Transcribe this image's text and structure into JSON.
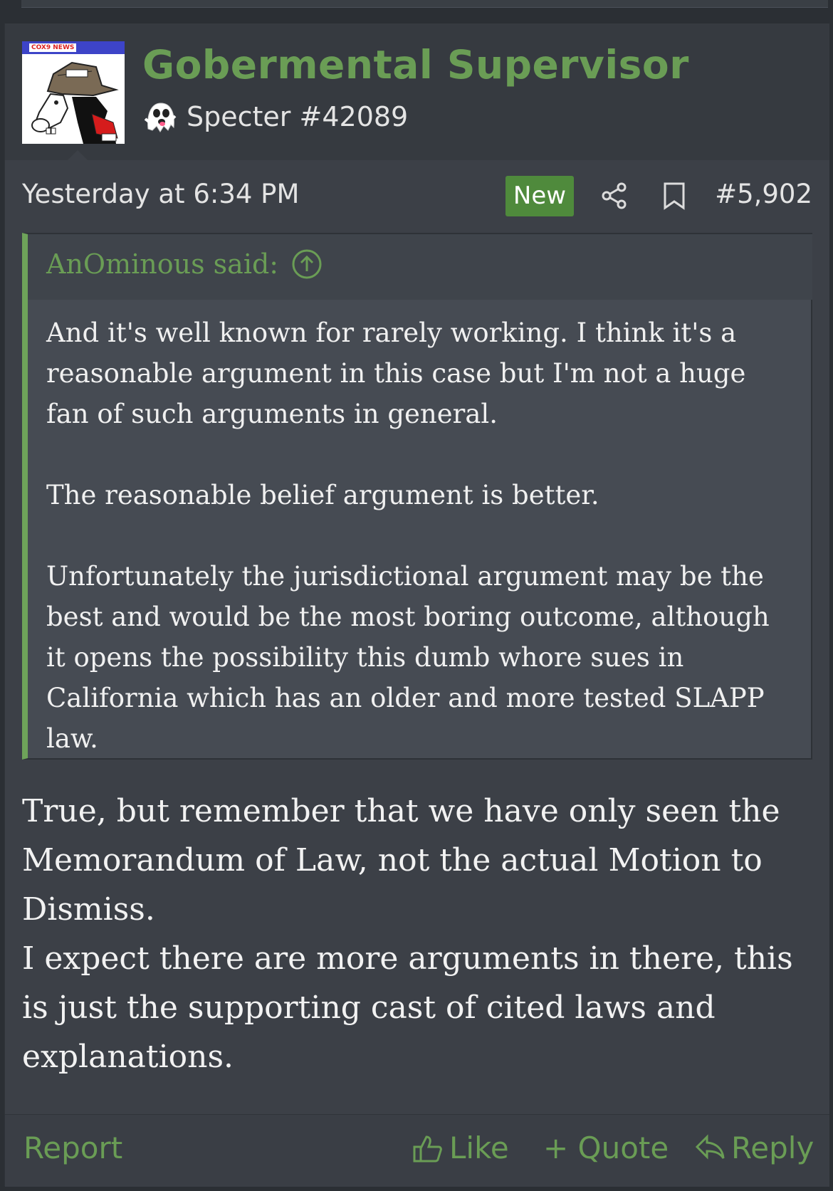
{
  "post": {
    "username": "Gobermental Supervisor",
    "user_title": "Specter #42089",
    "user_title_icon": "ghost-icon",
    "avatar_tag": "COX9 NEWS",
    "date": "Yesterday at 6:34 PM",
    "new_badge": "New",
    "post_number": "#5,902"
  },
  "quote": {
    "author": "AnOminous said:",
    "paragraphs": [
      "And it's well known for rarely working. I think it's a reasonable argument in this case but I'm not a huge fan of such arguments in general.",
      "The reasonable belief argument is better.",
      "Unfortunately the jurisdictional argument may be the best and would be the most boring outcome, although it opens the possibility this dumb whore sues in California which has an older and more tested SLAPP law."
    ]
  },
  "message": {
    "paragraphs": [
      "True, but remember that we have only seen the Memorandum of Law, not the actual Motion to Dismiss.",
      "I expect there are more arguments in there, this is just the supporting cast of cited laws and explanations."
    ]
  },
  "footer": {
    "report": "Report",
    "like": "Like",
    "quote": "+ Quote",
    "reply": "Reply"
  },
  "colors": {
    "accent": "#6a9d55",
    "new_badge": "#4f8a3c",
    "quote_bar": "#6ea35a",
    "background": "#3c4047"
  }
}
